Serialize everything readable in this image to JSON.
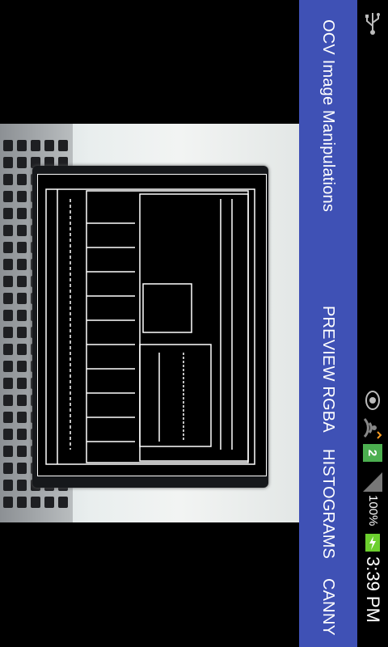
{
  "app": {
    "title": "OCV Image Manipulations"
  },
  "menu": {
    "items": [
      {
        "label": "PREVIEW RGBA"
      },
      {
        "label": "HISTOGRAMS"
      },
      {
        "label": "CANNY"
      }
    ]
  },
  "status_bar": {
    "time": "3:39 PM",
    "battery_percent": "100%",
    "notification_badge": "2",
    "icons": [
      "usb-icon",
      "eye-icon",
      "wifi-icon",
      "notification-badge-icon",
      "signal-icon",
      "battery-charging-icon"
    ]
  },
  "colors": {
    "action_bar": "#3f51b5",
    "status_bar": "#000000",
    "badge": "#4caf50"
  }
}
